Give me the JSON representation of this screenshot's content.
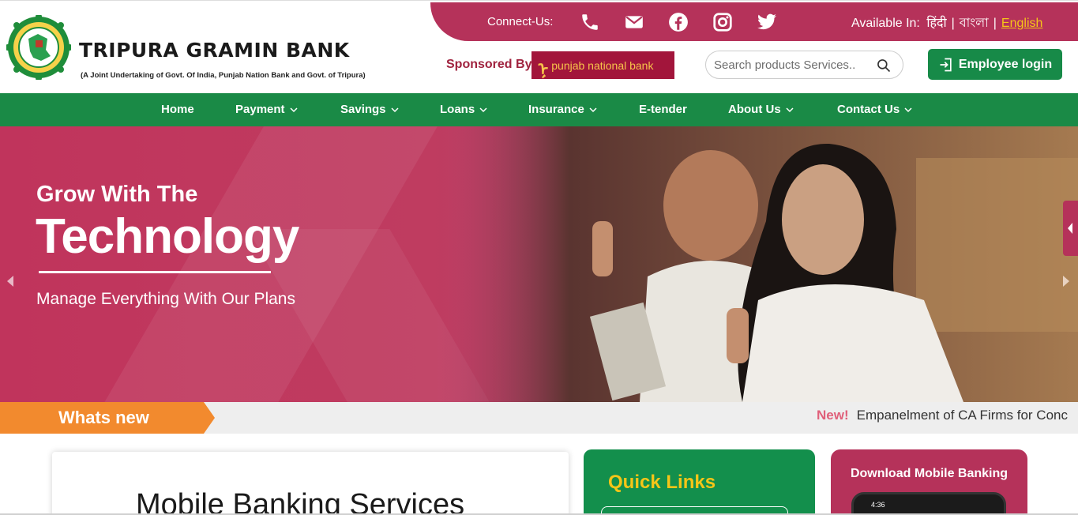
{
  "brand": {
    "name": "TRIPURA GRAMIN BANK",
    "subtitle": "(A Joint Undertaking of Govt. Of India, Punjab Nation Bank and Govt. of Tripura)"
  },
  "topbar": {
    "connect_label": "Connect-Us:",
    "social_icons": [
      "phone-icon",
      "mail-icon",
      "facebook-icon",
      "instagram-icon",
      "twitter-icon"
    ],
    "available_label": "Available In:",
    "languages": [
      "हिंदी",
      "বাংলা",
      "English"
    ],
    "active_language": "English",
    "separator": "|"
  },
  "sponsor": {
    "label": "Sponsored By",
    "logo_text": "punjab national bank"
  },
  "search": {
    "placeholder": "Search products Services.."
  },
  "employee_login": {
    "label": "Employee login"
  },
  "nav": {
    "items": [
      {
        "label": "Home",
        "dropdown": false
      },
      {
        "label": "Payment",
        "dropdown": true
      },
      {
        "label": "Savings",
        "dropdown": true
      },
      {
        "label": "Loans",
        "dropdown": true
      },
      {
        "label": "Insurance",
        "dropdown": true
      },
      {
        "label": "E-tender",
        "dropdown": false
      },
      {
        "label": "About Us",
        "dropdown": true
      },
      {
        "label": "Contact Us",
        "dropdown": true
      }
    ]
  },
  "hero": {
    "title_line1": "Grow With The",
    "title_line2": "Technology",
    "subtitle": "Manage Everything With Our Plans"
  },
  "whats_new": {
    "label": "Whats new",
    "badge": "New!",
    "ticker": "Empanelment of CA Firms for Conc"
  },
  "mobile_banking": {
    "title": "Mobile Banking Services"
  },
  "quick_links": {
    "title": "Quick Links"
  },
  "app_card": {
    "title": "Download Mobile Banking",
    "phone_time": "4:36"
  },
  "colors": {
    "primary": "#b5325a",
    "green": "#1a8a46",
    "accent": "#f5c518",
    "orange": "#f28a2e"
  }
}
